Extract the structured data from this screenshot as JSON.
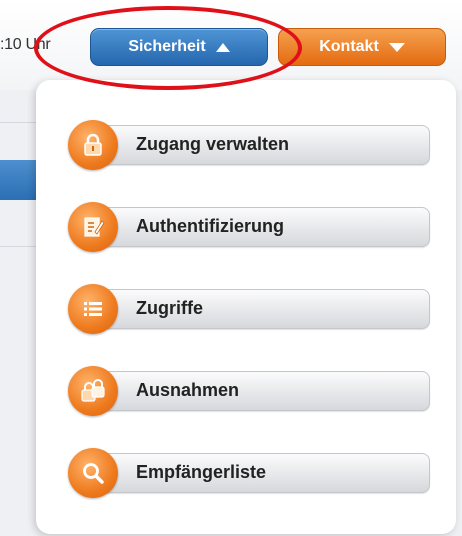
{
  "header": {
    "time_fragment": ":10 Uhr",
    "sicherheit_label": "Sicherheit",
    "kontakt_label": "Kontakt"
  },
  "menu": {
    "items": [
      {
        "label": "Zugang verwalten",
        "icon": "lock-icon"
      },
      {
        "label": "Authentifizierung",
        "icon": "edit-document-icon"
      },
      {
        "label": "Zugriffe",
        "icon": "list-icon"
      },
      {
        "label": "Ausnahmen",
        "icon": "double-lock-icon"
      },
      {
        "label": "Empfängerliste",
        "icon": "search-icon"
      }
    ]
  },
  "colors": {
    "accent_blue": "#2f74b8",
    "accent_orange": "#ee7a1e",
    "highlight_red": "#e01018"
  }
}
